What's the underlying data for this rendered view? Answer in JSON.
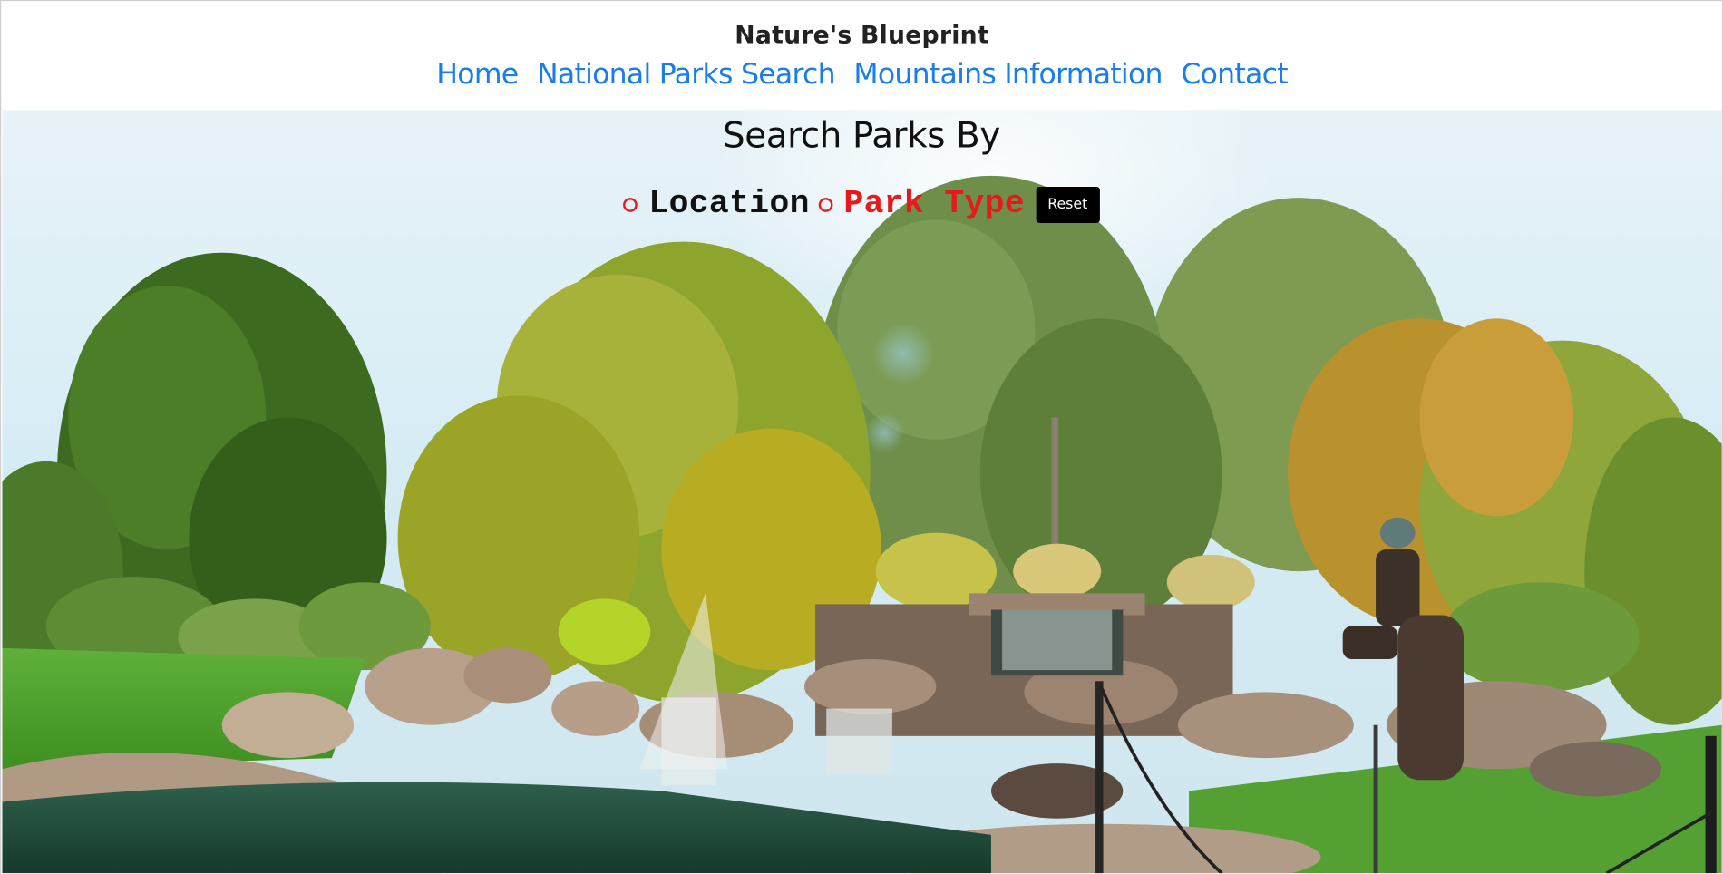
{
  "header": {
    "site_title": "Nature's Blueprint",
    "nav": [
      {
        "label": "Home"
      },
      {
        "label": "National Parks Search"
      },
      {
        "label": "Mountains Information"
      },
      {
        "label": "Contact"
      }
    ]
  },
  "search": {
    "heading": "Search Parks By",
    "options": [
      {
        "label": "Location",
        "selected": false
      },
      {
        "label": "Park Type",
        "selected": false
      }
    ],
    "reset_label": "Reset"
  },
  "colors": {
    "nav_link": "#1a7ee8",
    "radio_accent": "#e8191a",
    "reset_bg": "#000000"
  }
}
